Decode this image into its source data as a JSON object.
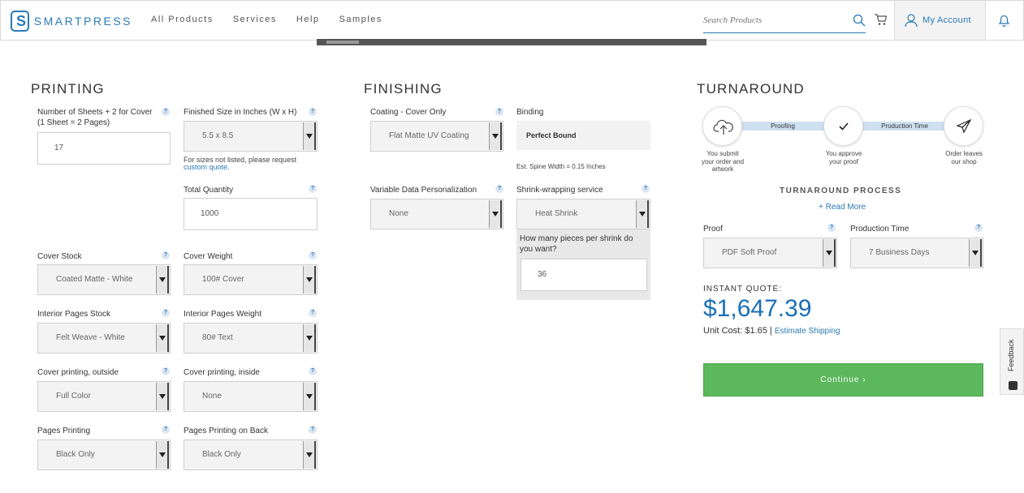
{
  "header": {
    "brand": "SMARTPRESS",
    "nav": [
      "All Products",
      "Services",
      "Help",
      "Samples"
    ],
    "search_placeholder": "Search Products",
    "account_label": "My Account"
  },
  "printing": {
    "title": "PRINTING",
    "sheets_label": "Number of Sheets + 2 for Cover\n(1 Sheet = 2 Pages)",
    "sheets_value": "17",
    "finished_size_label": "Finished Size in Inches (W x H)",
    "finished_size_value": "5.5 x 8.5",
    "size_note": "For sizes not listed, please request",
    "size_link": "custom quote",
    "size_period": ".",
    "total_qty_label": "Total Quantity",
    "total_qty_value": "1000",
    "cover_stock_label": "Cover Stock",
    "cover_stock_value": "Coated Matte - White",
    "cover_weight_label": "Cover Weight",
    "cover_weight_value": "100# Cover",
    "interior_stock_label": "Interior Pages Stock",
    "interior_stock_value": "Felt Weave - White",
    "interior_weight_label": "Interior Pages Weight",
    "interior_weight_value": "80# Text",
    "cover_outside_label": "Cover printing, outside",
    "cover_outside_value": "Full Color",
    "cover_inside_label": "Cover printing, inside",
    "cover_inside_value": "None",
    "pages_printing_label": "Pages Printing",
    "pages_printing_value": "Black Only",
    "pages_back_label": "Pages Printing on Back",
    "pages_back_value": "Black Only"
  },
  "finishing": {
    "title": "FINISHING",
    "coating_label": "Coating - Cover Only",
    "coating_value": "Flat Matte UV Coating",
    "binding_label": "Binding",
    "binding_value": "Perfect Bound",
    "spine_note": "Est. Spine Width = 0.15 Inches",
    "vdp_label": "Variable Data Personalization",
    "vdp_value": "None",
    "shrink_label": "Shrink-wrapping service",
    "shrink_value": "Heat Shrink",
    "shrink_question": "How many pieces per shrink do\nyou want?",
    "shrink_pieces": "36"
  },
  "turnaround": {
    "title": "TURNAROUND",
    "bar1": "Proofing",
    "bar2": "Production Time",
    "step1": "You submit\nyour order and\nartwork",
    "step2": "You approve\nyour proof",
    "step3": "Order leaves\nour shop",
    "process_title": "TURNAROUND PROCESS",
    "read_more": "+ Read More",
    "proof_label": "Proof",
    "proof_value": "PDF Soft Proof",
    "production_label": "Production Time",
    "production_value": "7 Business Days",
    "quote_label": "INSTANT QUOTE:",
    "quote_price": "$1,647.39",
    "unit_cost": "Unit Cost: $1.65 |",
    "estimate_shipping": "Estimate Shipping",
    "continue_label": "Continue ›"
  },
  "feedback_label": "Feedback",
  "help_glyph": "?",
  "colors": {
    "brand": "#2a7ab5",
    "price": "#1a6fb5",
    "continue": "#5cb85c"
  }
}
